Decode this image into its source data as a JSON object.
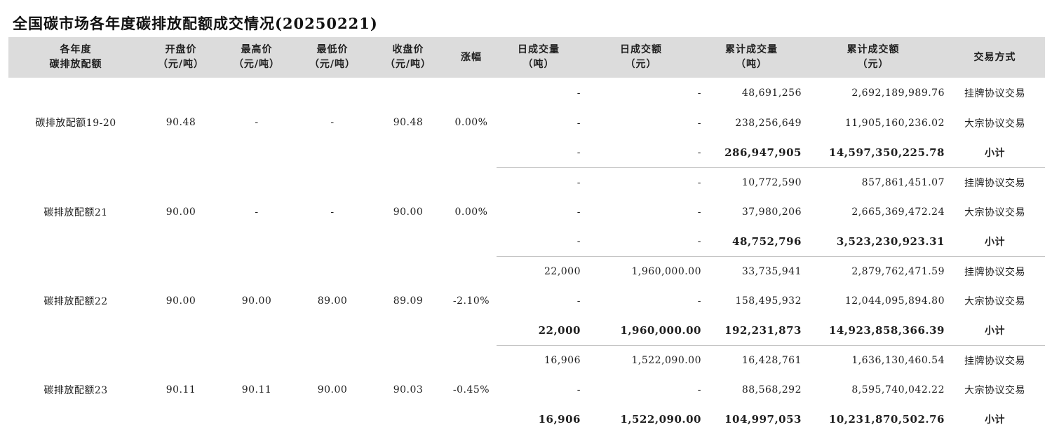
{
  "title": "全国碳市场各年度碳排放配额成交情况(20250221)",
  "headers": [
    [
      "各年度",
      "碳排放配额"
    ],
    [
      "开盘价",
      "（元/吨）"
    ],
    [
      "最高价",
      "（元/吨）"
    ],
    [
      "最低价",
      "（元/吨）"
    ],
    [
      "收盘价",
      "（元/吨）"
    ],
    [
      "涨幅"
    ],
    [
      "日成交量",
      "（吨）"
    ],
    [
      "日成交额",
      "（元）"
    ],
    [
      "累计成交量",
      "（吨）"
    ],
    [
      "累计成交额",
      "（元）"
    ],
    [
      "交易方式"
    ]
  ],
  "groups": [
    {
      "name": "碳排放配额19-20",
      "open": "90.48",
      "high": "-",
      "low": "-",
      "close": "90.48",
      "change": "0.00%",
      "rows": [
        {
          "daily_volume": "-",
          "daily_amount": "-",
          "cum_volume": "48,691,256",
          "cum_amount": "2,692,189,989.76",
          "method": "挂牌协议交易"
        },
        {
          "daily_volume": "-",
          "daily_amount": "-",
          "cum_volume": "238,256,649",
          "cum_amount": "11,905,160,236.02",
          "method": "大宗协议交易"
        },
        {
          "daily_volume": "-",
          "daily_amount": "-",
          "cum_volume": "286,947,905",
          "cum_amount": "14,597,350,225.78",
          "method": "小计"
        }
      ]
    },
    {
      "name": "碳排放配额21",
      "open": "90.00",
      "high": "-",
      "low": "-",
      "close": "90.00",
      "change": "0.00%",
      "rows": [
        {
          "daily_volume": "-",
          "daily_amount": "-",
          "cum_volume": "10,772,590",
          "cum_amount": "857,861,451.07",
          "method": "挂牌协议交易"
        },
        {
          "daily_volume": "-",
          "daily_amount": "-",
          "cum_volume": "37,980,206",
          "cum_amount": "2,665,369,472.24",
          "method": "大宗协议交易"
        },
        {
          "daily_volume": "-",
          "daily_amount": "-",
          "cum_volume": "48,752,796",
          "cum_amount": "3,523,230,923.31",
          "method": "小计"
        }
      ]
    },
    {
      "name": "碳排放配额22",
      "open": "90.00",
      "high": "90.00",
      "low": "89.00",
      "close": "89.09",
      "change": "-2.10%",
      "rows": [
        {
          "daily_volume": "22,000",
          "daily_amount": "1,960,000.00",
          "cum_volume": "33,735,941",
          "cum_amount": "2,879,762,471.59",
          "method": "挂牌协议交易"
        },
        {
          "daily_volume": "-",
          "daily_amount": "-",
          "cum_volume": "158,495,932",
          "cum_amount": "12,044,095,894.80",
          "method": "大宗协议交易"
        },
        {
          "daily_volume": "22,000",
          "daily_amount": "1,960,000.00",
          "cum_volume": "192,231,873",
          "cum_amount": "14,923,858,366.39",
          "method": "小计"
        }
      ]
    },
    {
      "name": "碳排放配额23",
      "open": "90.11",
      "high": "90.11",
      "low": "90.00",
      "close": "90.03",
      "change": "-0.45%",
      "rows": [
        {
          "daily_volume": "16,906",
          "daily_amount": "1,522,090.00",
          "cum_volume": "16,428,761",
          "cum_amount": "1,636,130,460.54",
          "method": "挂牌协议交易"
        },
        {
          "daily_volume": "-",
          "daily_amount": "-",
          "cum_volume": "88,568,292",
          "cum_amount": "8,595,740,042.22",
          "method": "大宗协议交易"
        },
        {
          "daily_volume": "16,906",
          "daily_amount": "1,522,090.00",
          "cum_volume": "104,997,053",
          "cum_amount": "10,231,870,502.76",
          "method": "小计"
        }
      ]
    }
  ]
}
